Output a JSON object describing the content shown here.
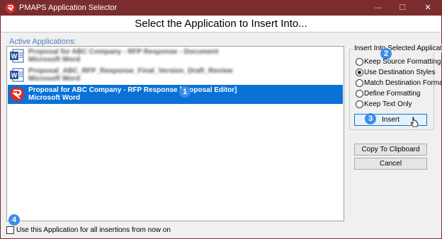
{
  "window": {
    "title": "PMAPS Application Selector",
    "minimize": "—",
    "maximize": "☐",
    "close": "✕"
  },
  "header": {
    "title": "Select the Application to Insert Into..."
  },
  "applications": {
    "label": "Active Applications:",
    "items": [
      {
        "line1": "Proposal for ABC Company - RFP Response - Document",
        "line2": "Microsoft Word",
        "icon": "word-icon",
        "blurred": true
      },
      {
        "line1": "Proposal_ABC_RFP_Response_Final_Version_Draft_Review",
        "line2": "Microsoft Word",
        "icon": "word-icon",
        "blurred": true
      },
      {
        "line1": "Proposal for ABC Company - RFP Response [Proposal Editor]",
        "line2": "Microsoft Word",
        "icon": "pmaps-icon",
        "selected": true
      }
    ]
  },
  "insert_options": {
    "group_label": "Insert Into Selected Application",
    "options": [
      {
        "label": "Keep Source Formatting",
        "checked": false
      },
      {
        "label": "Use Destination Styles",
        "checked": true
      },
      {
        "label": "Match Destination Formatting",
        "checked": false
      },
      {
        "label": "Define Formatting",
        "checked": false
      },
      {
        "label": "Keep Text Only",
        "checked": false
      }
    ]
  },
  "buttons": {
    "insert": "Insert",
    "copy": "Copy To Clipboard",
    "cancel": "Cancel"
  },
  "footer": {
    "checkbox_label": "Use this Application for all insertions from now on",
    "checked": false
  },
  "callouts": [
    "1",
    "2",
    "3",
    "4"
  ],
  "colors": {
    "titlebar": "#7b2d2d",
    "selection": "#0a72d6",
    "callout": "#3d8eea",
    "label_blue": "#4f81bd"
  }
}
